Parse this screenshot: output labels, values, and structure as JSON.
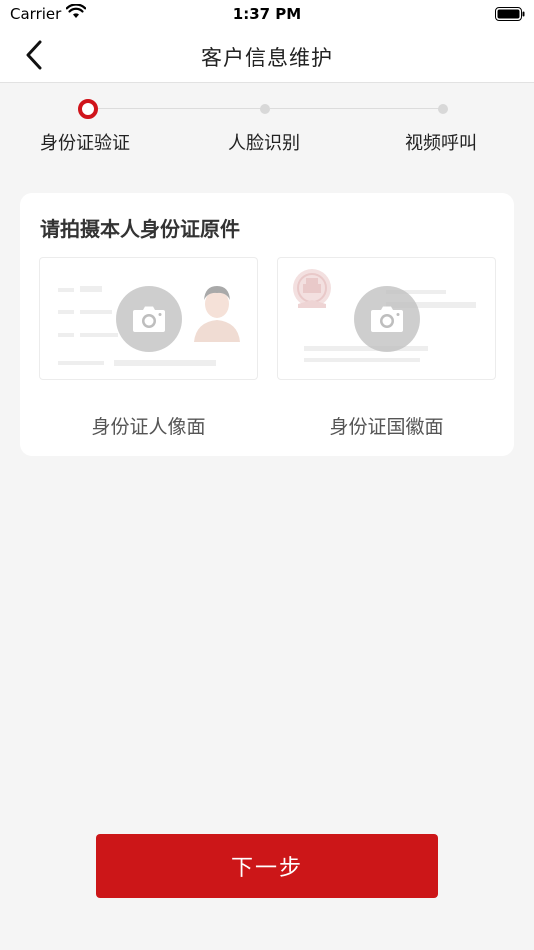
{
  "status_bar": {
    "carrier": "Carrier",
    "time": "1:37 PM"
  },
  "nav": {
    "title": "客户信息维护"
  },
  "steps": [
    {
      "label": "身份证验证",
      "state": "active"
    },
    {
      "label": "人脸识别",
      "state": "pending"
    },
    {
      "label": "视频呼叫",
      "state": "pending"
    }
  ],
  "card": {
    "title": "请拍摄本人身份证原件",
    "front_label": "身份证人像面",
    "back_label": "身份证国徽面"
  },
  "footer": {
    "next_label": "下一步"
  },
  "colors": {
    "accent": "#cc1618",
    "background": "#f5f5f5"
  },
  "icons": [
    "wifi-icon",
    "battery-icon",
    "back-chevron-icon",
    "camera-icon",
    "avatar-icon",
    "national-emblem-icon"
  ]
}
